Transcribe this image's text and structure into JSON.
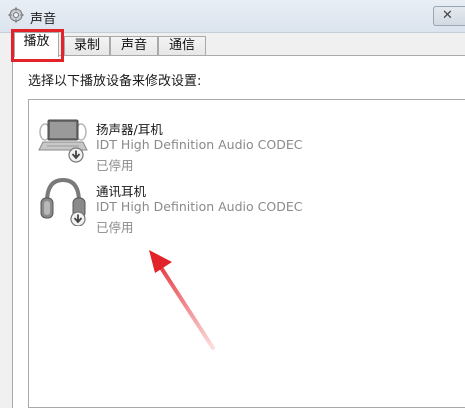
{
  "window": {
    "title": "声音",
    "close_glyph": "✕"
  },
  "tabs": [
    {
      "label": "播放",
      "active": true
    },
    {
      "label": "录制",
      "active": false
    },
    {
      "label": "声音",
      "active": false
    },
    {
      "label": "通信",
      "active": false
    }
  ],
  "instruction": "选择以下播放设备来修改设置:",
  "devices": [
    {
      "name": "扬声器/耳机",
      "driver": "IDT High Definition Audio CODEC",
      "status": "已停用",
      "icon": "speaker-laptop-icon"
    },
    {
      "name": "通讯耳机",
      "driver": "IDT High Definition Audio CODEC",
      "status": "已停用",
      "icon": "headphones-icon"
    }
  ],
  "colors": {
    "highlight_red": "#e3232a",
    "disabled_text": "#8a8a8a"
  }
}
